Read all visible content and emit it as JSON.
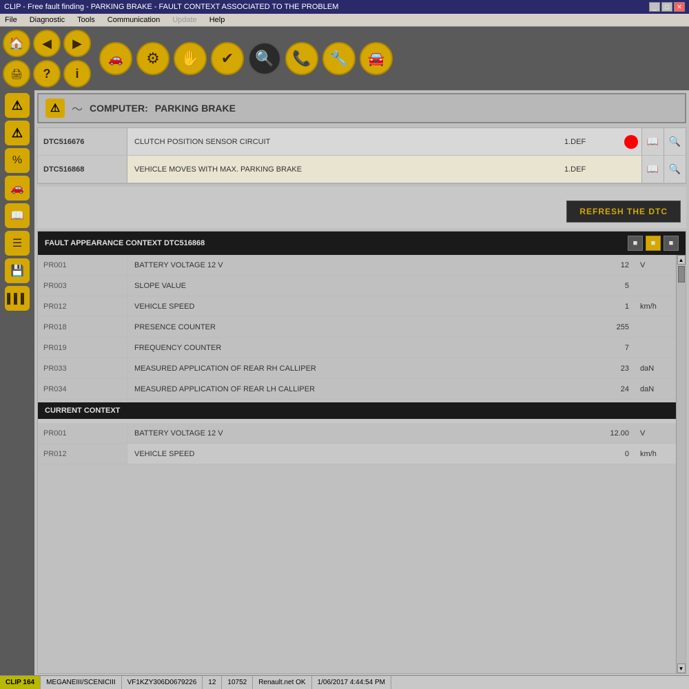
{
  "titleBar": {
    "title": "CLIP - Free fault finding - PARKING BRAKE - FAULT CONTEXT ASSOCIATED TO THE PROBLEM",
    "controls": [
      "_",
      "□",
      "✕"
    ]
  },
  "menuBar": {
    "items": [
      "File",
      "Diagnostic",
      "Tools",
      "Communication",
      "Update",
      "Help"
    ]
  },
  "toolbar": {
    "buttons": [
      {
        "icon": "🏠",
        "name": "home",
        "label": "Home"
      },
      {
        "icon": "◀",
        "name": "back",
        "label": "Back"
      },
      {
        "icon": "▶",
        "name": "forward",
        "label": "Forward"
      },
      {
        "icon": "🚗",
        "name": "vehicle",
        "label": "Vehicle"
      },
      {
        "icon": "⚙",
        "name": "transmission",
        "label": "Transmission"
      },
      {
        "icon": "✋",
        "name": "touch",
        "label": "Touch"
      },
      {
        "icon": "✔",
        "name": "check",
        "label": "Check"
      },
      {
        "icon": "🔍",
        "name": "search-active",
        "label": "Search Active"
      },
      {
        "icon": "📞",
        "name": "phone",
        "label": "Phone"
      },
      {
        "icon": "🔧",
        "name": "wrench",
        "label": "Wrench"
      },
      {
        "icon": "🚘",
        "name": "car-detail",
        "label": "Car Detail"
      }
    ],
    "sidebar": [
      {
        "icon": "⚠",
        "name": "warning1"
      },
      {
        "icon": "⚠",
        "name": "warning2"
      },
      {
        "icon": "📊",
        "name": "chart"
      },
      {
        "icon": "🚗",
        "name": "car"
      },
      {
        "icon": "📖",
        "name": "book"
      },
      {
        "icon": "📋",
        "name": "list"
      },
      {
        "icon": "💾",
        "name": "save"
      },
      {
        "icon": "|||",
        "name": "barcode"
      }
    ]
  },
  "computerHeader": {
    "label": "COMPUTER:",
    "name": "PARKING BRAKE"
  },
  "dtcTable": {
    "rows": [
      {
        "code": "DTC516676",
        "description": "CLUTCH POSITION SENSOR CIRCUIT",
        "status": "1.DEF",
        "hasRedDot": true
      },
      {
        "code": "DTC516868",
        "description": "VEHICLE MOVES WITH MAX. PARKING BRAKE",
        "status": "1.DEF",
        "hasRedDot": false
      }
    ]
  },
  "refreshButton": {
    "label": "REFRESH THE DTC"
  },
  "faultContext": {
    "header": "FAULT APPEARANCE CONTEXT DTC516868",
    "buttons": [
      "■",
      "■",
      "■"
    ],
    "rows": [
      {
        "code": "PR001",
        "description": "BATTERY VOLTAGE 12 V",
        "value": "12",
        "unit": "V"
      },
      {
        "code": "PR003",
        "description": "SLOPE VALUE",
        "value": "5",
        "unit": ""
      },
      {
        "code": "PR012",
        "description": "VEHICLE SPEED",
        "value": "1",
        "unit": "km/h"
      },
      {
        "code": "PR018",
        "description": "PRESENCE COUNTER",
        "value": "255",
        "unit": ""
      },
      {
        "code": "PR019",
        "description": "FREQUENCY COUNTER",
        "value": "7",
        "unit": ""
      },
      {
        "code": "PR033",
        "description": "MEASURED APPLICATION OF REAR RH CALLIPER",
        "value": "23",
        "unit": "daN"
      },
      {
        "code": "PR034",
        "description": "MEASURED APPLICATION OF REAR LH CALLIPER",
        "value": "24",
        "unit": "daN"
      }
    ]
  },
  "currentContext": {
    "header": "CURRENT CONTEXT",
    "rows": [
      {
        "code": "PR001",
        "description": "BATTERY VOLTAGE 12 V",
        "value": "12.00",
        "unit": "V"
      },
      {
        "code": "PR012",
        "description": "VEHICLE SPEED",
        "value": "0",
        "unit": "km/h"
      }
    ]
  },
  "statusBar": {
    "clip": "CLIP 164",
    "vehicle": "MEGANEIII/SCENICIII",
    "vin": "VF1KZY306D0679226",
    "number1": "12",
    "number2": "10752",
    "network": "Renault.net OK",
    "datetime": "1/06/2017 4:44:54 PM"
  }
}
